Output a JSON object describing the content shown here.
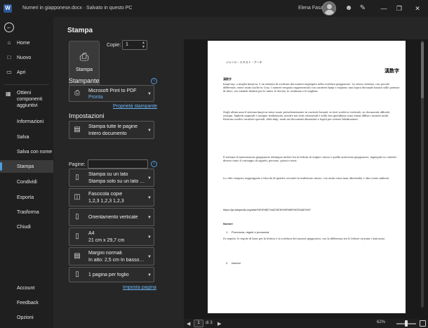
{
  "titlebar": {
    "app_logo": "W",
    "doc_title": "Numeri in giapponese.docx · Salvato in questo PC",
    "user_name": "Elena Fasano",
    "icons": [
      "shield-icon",
      "person-icon",
      "pen-icon"
    ],
    "window_buttons": [
      "minimize",
      "restore",
      "close"
    ]
  },
  "nav": {
    "items": [
      {
        "label": "Home",
        "icon": "home-icon"
      },
      {
        "label": "Nuovo",
        "icon": "new-icon"
      },
      {
        "label": "Apri",
        "icon": "folder-icon"
      },
      {
        "label": "Ottieni componenti aggiuntivi",
        "icon": "grid-icon"
      },
      {
        "label": "Informazioni"
      },
      {
        "label": "Salva"
      },
      {
        "label": "Salva con nome"
      },
      {
        "label": "Stampa",
        "active": true
      },
      {
        "label": "Condividi"
      },
      {
        "label": "Esporta"
      },
      {
        "label": "Trasforma"
      },
      {
        "label": "Chiudi"
      },
      {
        "label": "Account"
      },
      {
        "label": "Feedback"
      },
      {
        "label": "Opzioni"
      }
    ]
  },
  "print": {
    "title": "Stampa",
    "print_button": "Stampa",
    "copies_label": "Copie:",
    "copies_value": "1",
    "printer_heading": "Stampante",
    "printer_name": "Microsoft Print to PDF",
    "printer_status": "Pronta",
    "printer_properties_link": "Proprietà stampante",
    "settings_heading": "Impostazioni",
    "settings": [
      {
        "l1": "Stampa tutte le pagine",
        "l2": "Intero documento"
      },
      {
        "l1": "Stampa su un lato",
        "l2": "Stampa solo su un lato della..."
      },
      {
        "l1": "Fascicola copie",
        "l2": "1,2,3    1,2,3    1,2,3"
      },
      {
        "l1": "Orientamento verticale",
        "l2": ""
      },
      {
        "l1": "A4",
        "l2": "21 cm x 29,7 cm"
      },
      {
        "l1": "Margini normali",
        "l2": "In alto: 2,5 cm In basso: 2 cm..."
      },
      {
        "l1": "1 pagina per foglio",
        "l2": ""
      }
    ],
    "pages_label": "Pagine:",
    "pages_value": "",
    "page_setup_link": "Imposta pagina"
  },
  "preview": {
    "header": "ジャンル・テキスト・アーキ",
    "title": "漢数字",
    "subtitle": "漢数字",
    "para1": "Kanji-suji, o meglio kanji-su, è un sistema di scrittura dei numeri impiegato nella scrittura giapponese. Lo stesso sistema, con piccole differenze, viene usato anche in Cina. I numeri vengono rappresentati con caratteri kanji e seguono una logica decimale basata sulle potenze di dieci, con simboli distinti per le unità, le decine, le centinaia e le migliaia.",
    "para2": "Negli ultimi anni il sistema kanji-su viene usato prevalentemente in contesti formali, in testi scritti in verticale, su documenti ufficiali, assegni, biglietti augurali e insegne tradizionali, mentre nei testi orizzontali e nella vita quotidiana sono ormai diffusi i numeri arabi. Esistono inoltre caratteri speciali, detti daiji, usati nei documenti finanziari e legali per evitare falsificazioni.",
    "para3": "Il sistema di numerazione giapponese distingue inoltre tra la lettura di origine cinese e quella autoctona giapponese, impiegate in contesti diversi come il conteggio di oggetti, persone, giorni e mesi.",
    "para4": "Le cifre vengono raggruppate a blocchi di quattro secondo la tradizione cinese, con unità come man (diecimila) e oku (cento milioni).",
    "url": "https://ja.wikipedia.org/wiki/%E6%BC%A2%E6%95%B0%E5%AD%97",
    "section": "Numeri",
    "li1": "Pronuncia, regole e pronuncia",
    "para5": "Di seguito, le regole di base per la lettura e la scrittura dei numeri giapponesi, con la differenza tra le letture on'yomi e kun'yomi.",
    "li2": "Numeri"
  },
  "bottombar": {
    "page_current": "1",
    "page_of": "di 3",
    "zoom": "62%"
  }
}
